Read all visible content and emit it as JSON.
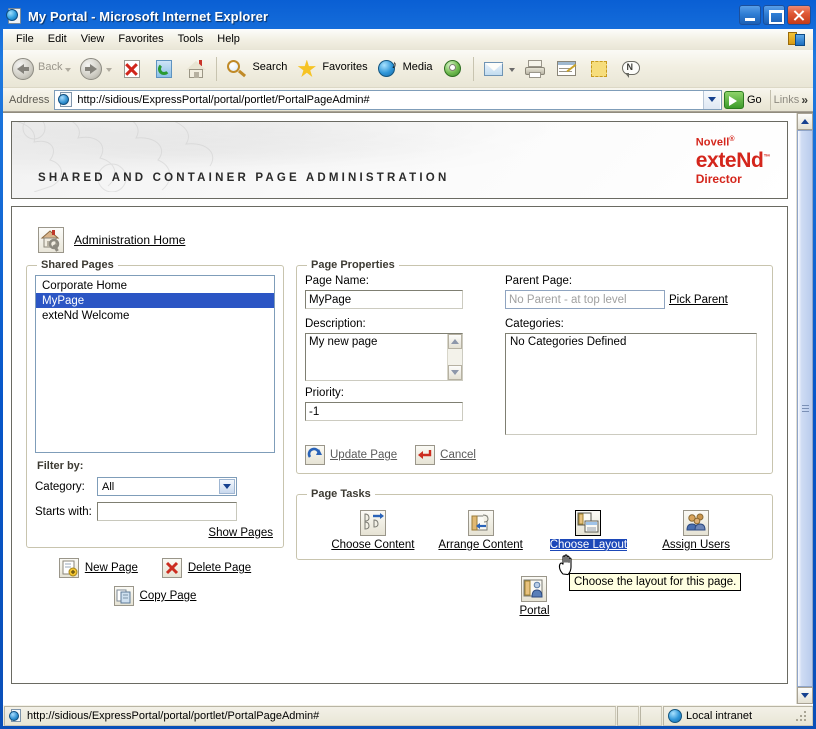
{
  "window": {
    "title": "My Portal - Microsoft Internet Explorer",
    "icon": "ie-document-icon",
    "minimize_label": "Minimize",
    "maximize_label": "Maximize",
    "close_label": "Close"
  },
  "menubar": {
    "items": [
      {
        "label": "File"
      },
      {
        "label": "Edit"
      },
      {
        "label": "View"
      },
      {
        "label": "Favorites"
      },
      {
        "label": "Tools"
      },
      {
        "label": "Help"
      }
    ]
  },
  "toolbar": {
    "back_label": "Back",
    "forward_label": "",
    "search_label": "Search",
    "favorites_label": "Favorites",
    "media_label": "Media",
    "icons": [
      "back-icon",
      "forward-icon",
      "stop-icon",
      "refresh-icon",
      "home-icon",
      "search-icon",
      "favorites-star-icon",
      "media-icon",
      "history-icon",
      "mail-icon",
      "print-icon",
      "edit-icon",
      "notes-icon",
      "messenger-icon"
    ]
  },
  "address": {
    "label": "Address",
    "value": "http://sidious/ExpressPortal/portal/portlet/PortalPageAdmin#",
    "placeholder": "",
    "go_label": "Go",
    "links_label": "Links",
    "chevron": "»"
  },
  "banner": {
    "title": "SHARED AND CONTAINER PAGE ADMINISTRATION",
    "brand_line1": "Novell",
    "brand_line1_sup": "®",
    "brand_line2": "exteNd",
    "brand_line2_sup": "™",
    "brand_line3": "Director",
    "brand_color": "#d4261c"
  },
  "admin_home": {
    "label": "Administration Home",
    "icon": "house-wrench-icon"
  },
  "shared_pages": {
    "legend": "Shared Pages",
    "items": [
      {
        "label": "Corporate Home",
        "selected": false
      },
      {
        "label": "MyPage",
        "selected": true
      },
      {
        "label": "exteNd Welcome",
        "selected": false
      }
    ],
    "selection_color": "#2b55c4",
    "filter_header": "Filter by:",
    "category_label": "Category:",
    "category_value": "All",
    "starts_with_label": "Starts with:",
    "starts_with_value": "",
    "starts_with_placeholder": "",
    "show_pages_label": "Show Pages"
  },
  "page_actions": {
    "new_page_label": "New Page",
    "delete_page_label": "Delete Page",
    "copy_page_label": "Copy Page",
    "new_page_icon": "page-add-icon",
    "delete_page_icon": "red-x-icon",
    "copy_page_icon": "copy-page-icon"
  },
  "page_properties": {
    "legend": "Page Properties",
    "page_name_label": "Page Name:",
    "page_name_value": "MyPage",
    "description_label": "Description:",
    "description_value": "My new page",
    "priority_label": "Priority:",
    "priority_value": "-1",
    "parent_page_label": "Parent Page:",
    "parent_page_value": "No Parent - at top level",
    "pick_parent_label": "Pick Parent",
    "categories_label": "Categories:",
    "categories_value": "No Categories Defined",
    "update_label": "Update Page",
    "cancel_label": "Cancel",
    "update_icon": "blue-refresh-arrow-icon",
    "cancel_icon": "red-return-arrow-icon"
  },
  "page_tasks": {
    "legend": "Page Tasks",
    "items": [
      {
        "label": "Choose Content",
        "icon": "choose-content-icon",
        "active": false
      },
      {
        "label": "Arrange Content",
        "icon": "arrange-content-icon",
        "active": false
      },
      {
        "label": "Choose Layout",
        "icon": "choose-layout-icon",
        "active": true
      },
      {
        "label": "Assign Users",
        "icon": "assign-users-icon",
        "active": false
      }
    ],
    "portal_label": "Portal",
    "portal_icon": "portal-icon",
    "tooltip": "Choose the layout for this page.",
    "highlight_color": "#1c48b8"
  },
  "statusbar": {
    "url": "http://sidious/ExpressPortal/portal/portlet/PortalPageAdmin#",
    "zone": "Local intranet",
    "zone_icon": "globe-icon"
  }
}
